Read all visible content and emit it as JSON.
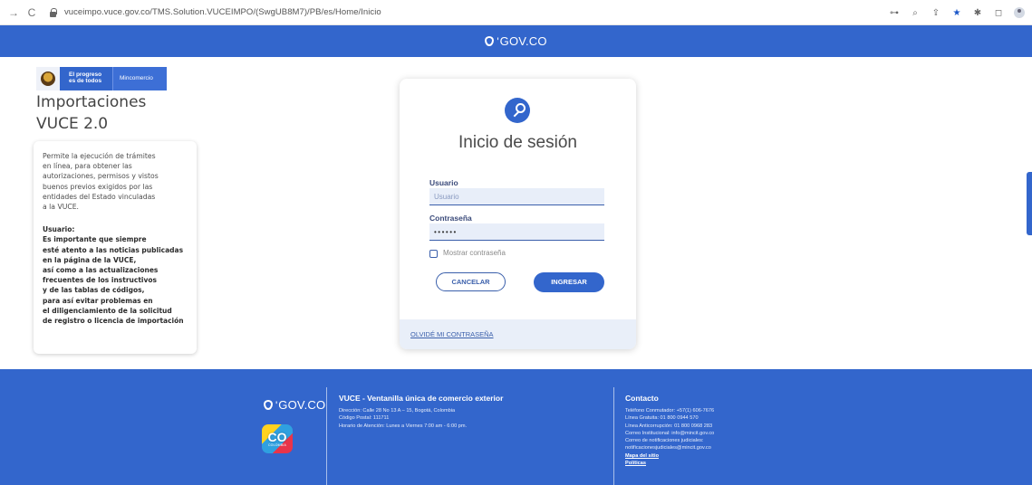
{
  "browser": {
    "url": "vuceimpo.vuce.gov.co/TMS.Solution.VUCEIMPO/(SwgUB8M7)/PB/es/Home/Inicio"
  },
  "header": {
    "gov_logo": "GOV.CO"
  },
  "brand": {
    "progreso": "El progreso es de todos",
    "ministry": "Mincomercio"
  },
  "page": {
    "title_line1": "Importaciones",
    "title_line2": "VUCE 2.0"
  },
  "info": {
    "description": [
      "Permite la ejecución de trámites",
      "en línea, para obtener las",
      "autorizaciones, permisos y vistos",
      "buenos previos exigidos por las",
      "entidades del Estado vinculadas",
      "a la VUCE."
    ],
    "notice": [
      "Usuario:",
      "Es importante que siempre",
      "esté atento a las noticias publicadas",
      "en la página de la VUCE,",
      "así como a las actualizaciones",
      "frecuentes de los instructivos",
      "y de las tablas de códigos,",
      "para así evitar problemas en",
      "el diligenciamiento de la solicitud",
      "de registro o licencia de importación"
    ]
  },
  "login": {
    "title": "Inicio de sesión",
    "user_label": "Usuario",
    "user_placeholder": "Usuario",
    "user_value": "",
    "password_label": "Contraseña",
    "password_value": "••••••",
    "show_password_label": "Mostrar contraseña",
    "cancel_label": "CANCELAR",
    "submit_label": "INGRESAR",
    "forgot_label": "OLVIDÉ MI CONTRASEÑA"
  },
  "footer": {
    "gov_logo": "GOV.CO",
    "co_text": "CO",
    "co_sub": "COLOMBIA",
    "vuce_title": "VUCE - Ventanilla única de comercio exterior",
    "vuce_lines": [
      "Dirección: Calle 28 No 13 A – 15, Bogotá, Colombia",
      "Código Postal: 111711",
      "Horario de Atención: Lunes a Viernes 7:00 am - 6:00 pm."
    ],
    "contact_title": "Contacto",
    "contact_lines": [
      "Teléfono Conmutador: +57(1) 606-7676",
      "Línea Gratuita: 01 800 0944 570",
      "Línea Anticorrupción: 01 800 0968 283",
      "Correo Institucional: info@mincit.gov.co",
      "Correo de notificaciones judiciales:",
      "notificacionesjudiciales@mincit.gov.co"
    ],
    "sitemap_label": "Mapa del sitio",
    "policies_label": "Políticas"
  }
}
